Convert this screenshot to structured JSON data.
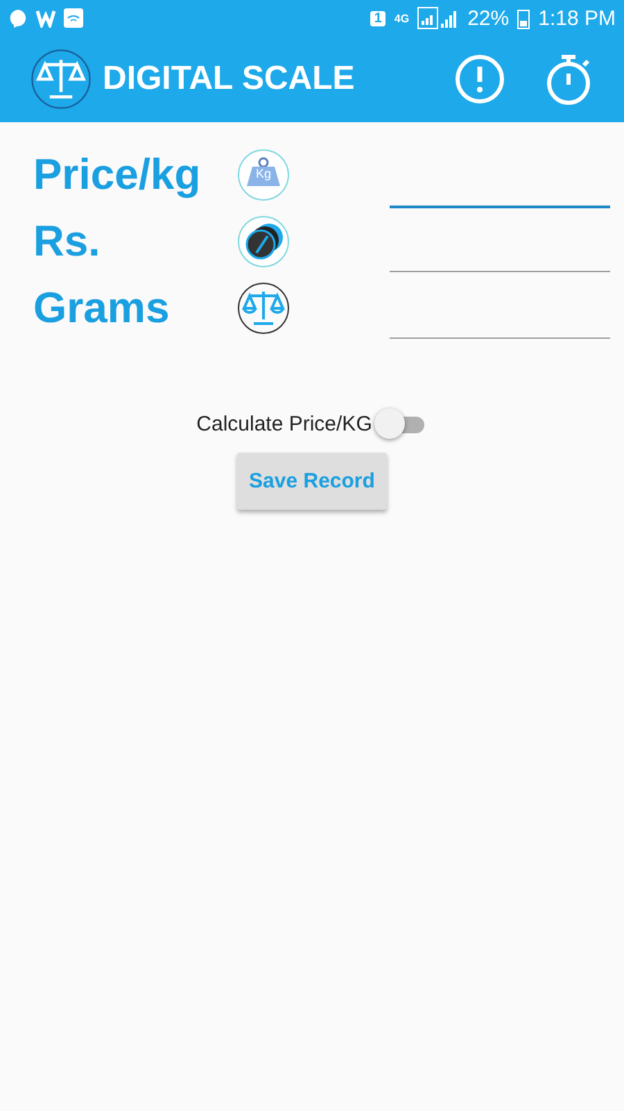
{
  "status_bar": {
    "sim": "1",
    "network": "4G",
    "battery": "22%",
    "time": "1:18 PM"
  },
  "app_bar": {
    "title": "DIGITAL SCALE"
  },
  "rows": [
    {
      "label": "Price/kg",
      "kind": "weight",
      "icon_text": "Kg",
      "focused": true
    },
    {
      "label": "Rs.",
      "kind": "coins",
      "focused": false
    },
    {
      "label": "Grams",
      "kind": "scale",
      "focused": false
    }
  ],
  "toggle": {
    "label": "Calculate Price/KG",
    "on": false
  },
  "save_button": "Save Record"
}
